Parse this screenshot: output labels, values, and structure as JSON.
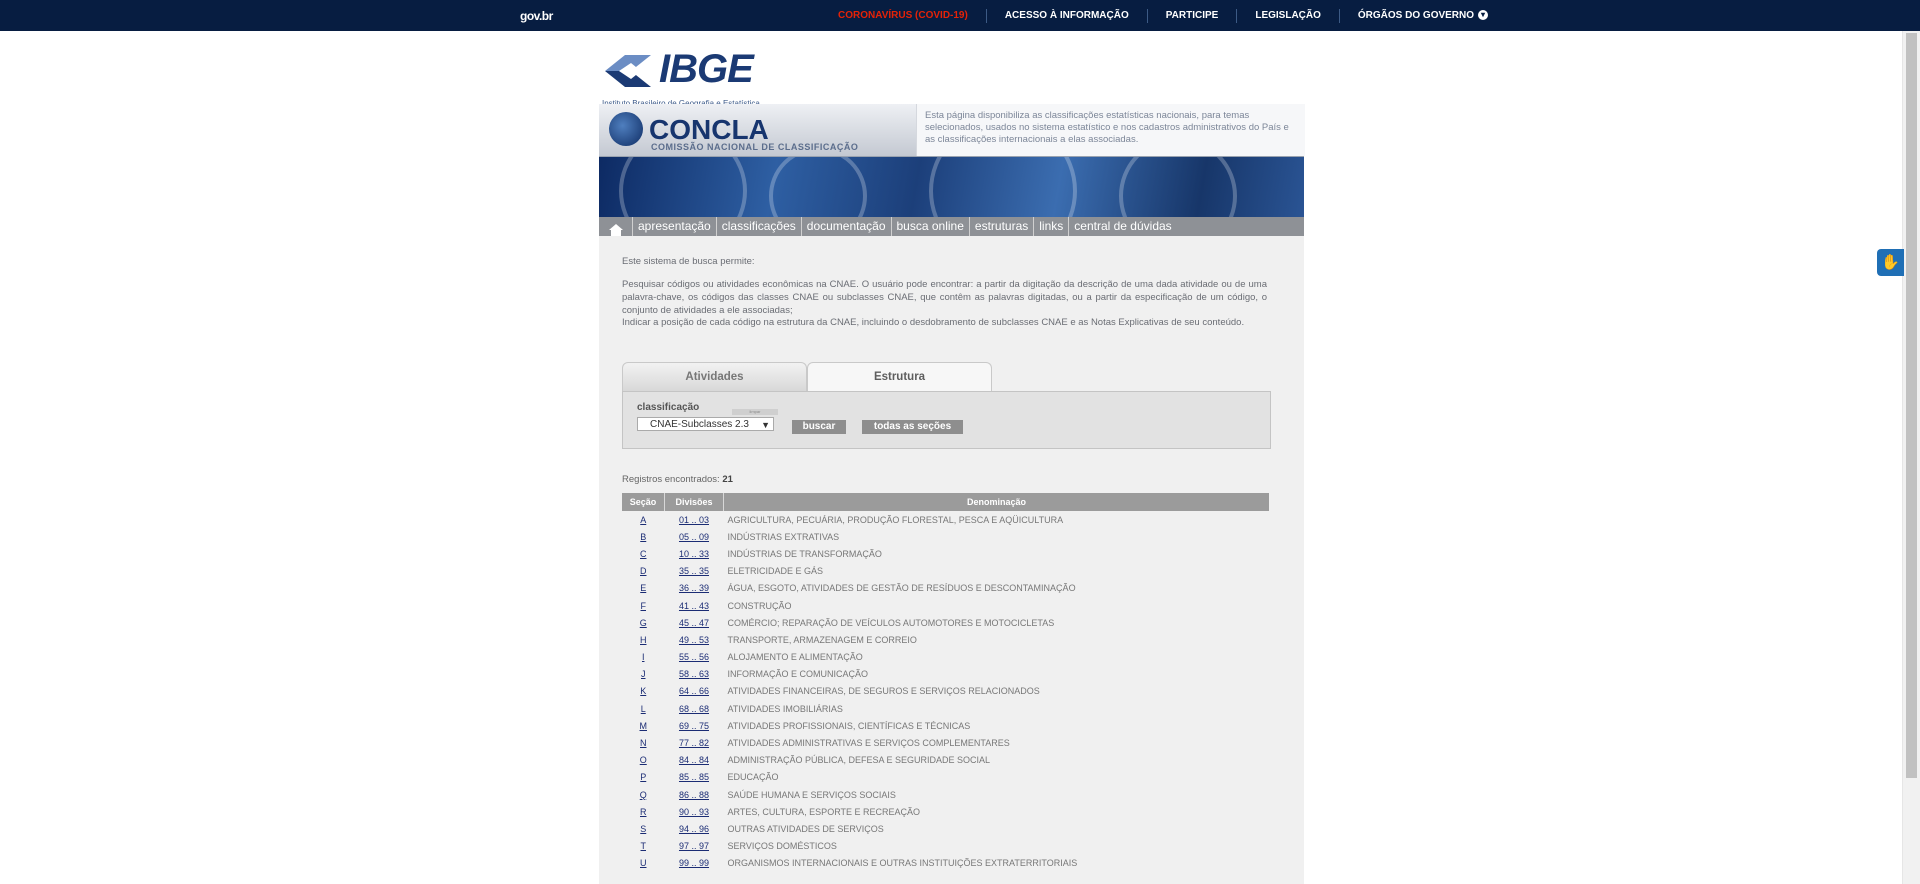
{
  "govbar": {
    "logo": "gov.br",
    "links": [
      "CORONAVÍRUS (COVID-19)",
      "ACESSO À INFORMAÇÃO",
      "PARTICIPE",
      "LEGISLAÇÃO",
      "ÓRGÃOS DO GOVERNO"
    ],
    "covid_color": "#e52207"
  },
  "ibge": {
    "name": "IBGE",
    "subtitle": "Instituto Brasileiro de Geografia e Estatística"
  },
  "concla": {
    "name": "CONCLA",
    "subtitle": "COMISSÃO NACIONAL DE CLASSIFICAÇÃO",
    "description": "Esta página disponibiliza as classificações estatísticas nacionais, para temas selecionados, usados no sistema estatístico e nos cadastros administrativos do País e as classificações internacionais a elas associadas."
  },
  "menu": {
    "home_icon": "home-icon",
    "items": [
      "apresentação",
      "classificações",
      "documentação",
      "busca online",
      "estruturas",
      "links",
      "central de dúvidas"
    ]
  },
  "intro": {
    "p1": "Este sistema de busca permite:",
    "p2": "Pesquisar códigos ou atividades econômicas na CNAE. O usuário pode encontrar: a partir da digitação da descrição de uma dada atividade ou de uma palavra-chave, os códigos das classes CNAE ou subclasses CNAE, que contêm as palavras digitadas, ou a partir da especificação de um código, o conjunto de atividades a ele associadas;",
    "p3": "Indicar a posição de cada código na estrutura da CNAE, incluindo o desdobramento de subclasses CNAE e as Notas Explicativas de seu conteúdo."
  },
  "tabs": [
    "Atividades",
    "Estrutura"
  ],
  "search": {
    "label": "classificação",
    "clear": "limpar",
    "selected": "CNAE-Subclasses 2.3",
    "buscar": "buscar",
    "todas": "todas as seções"
  },
  "results": {
    "label": "Registros encontrados:",
    "count": "21",
    "headers": [
      "Seção",
      "Divisões",
      "Denominação"
    ],
    "rows": [
      [
        "A",
        "01 .. 03",
        "AGRICULTURA, PECUÁRIA, PRODUÇÃO FLORESTAL, PESCA E AQÜICULTURA"
      ],
      [
        "B",
        "05 .. 09",
        "INDÚSTRIAS EXTRATIVAS"
      ],
      [
        "C",
        "10 .. 33",
        "INDÚSTRIAS DE TRANSFORMAÇÃO"
      ],
      [
        "D",
        "35 .. 35",
        "ELETRICIDADE E GÁS"
      ],
      [
        "E",
        "36 .. 39",
        "ÁGUA, ESGOTO, ATIVIDADES DE GESTÃO DE RESÍDUOS E DESCONTAMINAÇÃO"
      ],
      [
        "F",
        "41 .. 43",
        "CONSTRUÇÃO"
      ],
      [
        "G",
        "45 .. 47",
        "COMÉRCIO; REPARAÇÃO DE VEÍCULOS AUTOMOTORES E MOTOCICLETAS"
      ],
      [
        "H",
        "49 .. 53",
        "TRANSPORTE, ARMAZENAGEM E CORREIO"
      ],
      [
        "I",
        "55 .. 56",
        "ALOJAMENTO E ALIMENTAÇÃO"
      ],
      [
        "J",
        "58 .. 63",
        "INFORMAÇÃO E COMUNICAÇÃO"
      ],
      [
        "K",
        "64 .. 66",
        "ATIVIDADES FINANCEIRAS, DE SEGUROS E SERVIÇOS RELACIONADOS"
      ],
      [
        "L",
        "68 .. 68",
        "ATIVIDADES IMOBILIÁRIAS"
      ],
      [
        "M",
        "69 .. 75",
        "ATIVIDADES PROFISSIONAIS, CIENTÍFICAS E TÉCNICAS"
      ],
      [
        "N",
        "77 .. 82",
        "ATIVIDADES ADMINISTRATIVAS E SERVIÇOS COMPLEMENTARES"
      ],
      [
        "O",
        "84 .. 84",
        "ADMINISTRAÇÃO PÚBLICA, DEFESA E SEGURIDADE SOCIAL"
      ],
      [
        "P",
        "85 .. 85",
        "EDUCAÇÃO"
      ],
      [
        "Q",
        "86 .. 88",
        "SAÚDE HUMANA E SERVIÇOS SOCIAIS"
      ],
      [
        "R",
        "90 .. 93",
        "ARTES, CULTURA, ESPORTE E RECREAÇÃO"
      ],
      [
        "S",
        "94 .. 96",
        "OUTRAS ATIVIDADES DE SERVIÇOS"
      ],
      [
        "T",
        "97 .. 97",
        "SERVIÇOS DOMÉSTICOS"
      ],
      [
        "U",
        "99 .. 99",
        "ORGANISMOS INTERNACIONAIS E OUTRAS INSTITUIÇÕES EXTRATERRITORIAIS"
      ]
    ]
  },
  "accessibility_icon": "hand-sign-icon"
}
